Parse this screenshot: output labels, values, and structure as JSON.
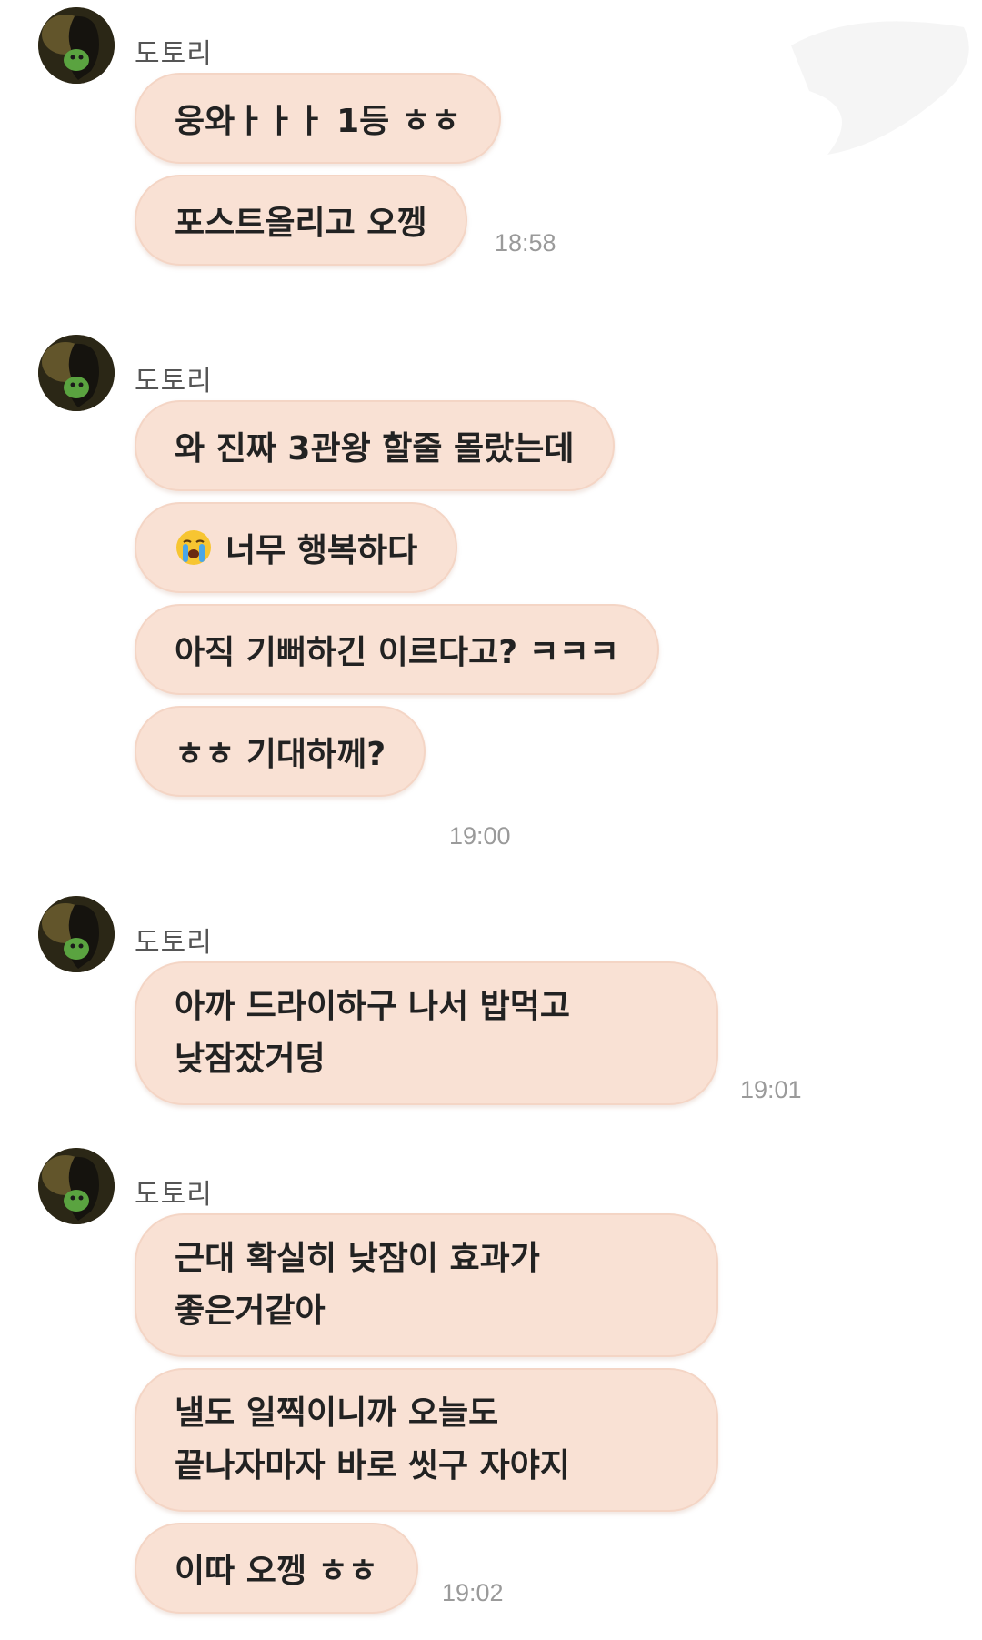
{
  "colors": {
    "bubble_bg": "#f9e1d4",
    "bubble_border": "#f4d5c5",
    "timestamp": "#9a9a9a",
    "sender": "#555555"
  },
  "groups": [
    {
      "sender": "도토리",
      "messages": [
        "웅와ㅏㅏㅏ 1등 ㅎㅎ",
        "포스트올리고 오껭"
      ],
      "time": "18:58"
    },
    {
      "sender": "도토리",
      "messages": [
        "와 진짜 3관왕 할줄 몰랐는데",
        "너무 행복하다",
        "아직 기뻐하긴 이르다고? ㅋㅋㅋ",
        "ㅎㅎ 기대하께?"
      ],
      "emoji": "crying-face-emoji",
      "time": "19:00"
    },
    {
      "sender": "도토리",
      "messages": [
        [
          "아까 드라이하구 나서 밥먹고",
          "낮잠잤거덩"
        ]
      ],
      "time": "19:01"
    },
    {
      "sender": "도토리",
      "messages": [
        [
          "근대 확실히 낮잠이 효과가",
          "좋은거같아"
        ],
        [
          "낼도 일찍이니까 오늘도",
          "끝나자마자 바로 씻구 자야지"
        ],
        "이따 오껭 ㅎㅎ"
      ],
      "time": "19:02"
    }
  ]
}
